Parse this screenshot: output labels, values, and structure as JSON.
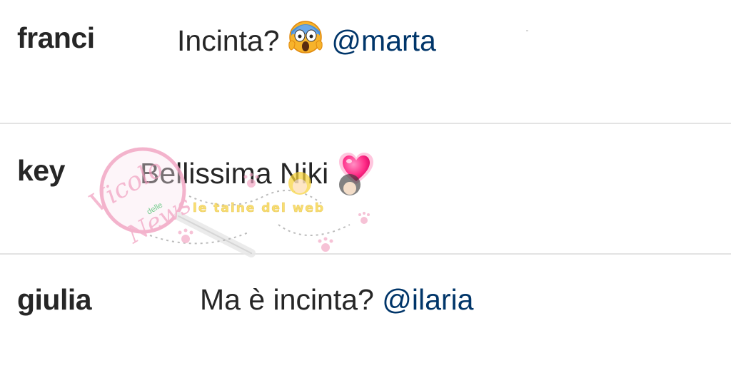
{
  "comments": [
    {
      "username": "franci",
      "text": "Incinta?",
      "emoji": "face-screaming-in-fear-icon",
      "mention": "@marta"
    },
    {
      "username": "key",
      "text": "Bellissima Niki",
      "emoji": "sparkling-heart-icon",
      "mention": ""
    },
    {
      "username": "giulia",
      "text": "Ma è incinta?",
      "emoji": "",
      "mention": "@ilaria"
    }
  ],
  "watermark": {
    "logo_text": [
      "Vicolo",
      "delle",
      "News"
    ],
    "tagline": "le taine del web"
  },
  "colors": {
    "text": "#262626",
    "mention": "#003569",
    "divider": "#e3e3e3",
    "heart": "#ff2d87",
    "watermark_pink": "#f2a6c4",
    "watermark_yellow": "#f7d23a"
  }
}
